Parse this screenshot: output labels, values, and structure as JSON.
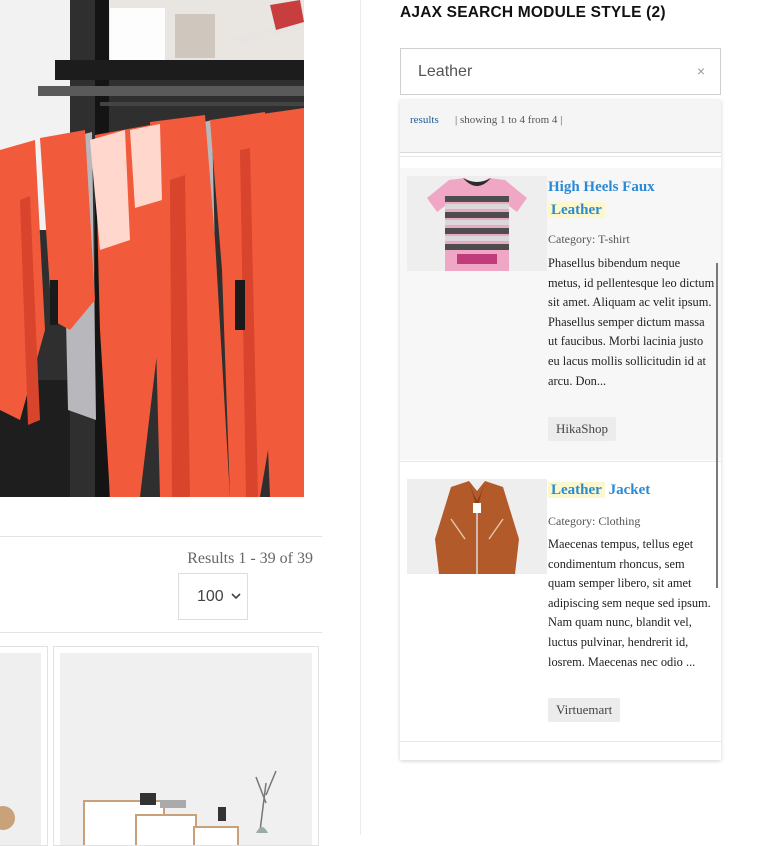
{
  "listing": {
    "results_count": "Results 1 - 39 of 39",
    "limit": {
      "value": "100",
      "icon": "chevron-down-icon"
    }
  },
  "module": {
    "title": "AJAX SEARCH MODULE STYLE (2)",
    "search": {
      "value": "Leather",
      "clear_icon": "×"
    },
    "results": {
      "tab_label": "results",
      "showing": "| showing 1 to 4 from 4 |",
      "items": [
        {
          "title_prefix": "High Heels Faux",
          "title_highlight": "Leather",
          "title_suffix": "",
          "category": "Category: T-shirt",
          "description": "Phasellus bibendum neque metus, id pellentesque leo dictum sit amet. Aliquam ac velit ipsum. Phasellus semper dictum massa ut faucibus. Morbi lacinia justo eu lacus mollis sollicitudin id at arcu. Don...",
          "source": "HikaShop"
        },
        {
          "title_prefix": "",
          "title_highlight": "Leather",
          "title_suffix": "Jacket",
          "category": "Category: Clothing",
          "description": "Maecenas tempus, tellus eget condimentum rhoncus, sem quam semper libero, sit amet adipiscing sem neque sed ipsum. Nam quam nunc, blandit vel, luctus pulvinar, hendrerit id, losrem. Maecenas nec odio ...",
          "source": "Virtuemart"
        }
      ]
    }
  },
  "colors": {
    "link": "#2a8ad3",
    "highlight_bg": "#fbf8ce",
    "tab_link": "#1a5b9a"
  }
}
